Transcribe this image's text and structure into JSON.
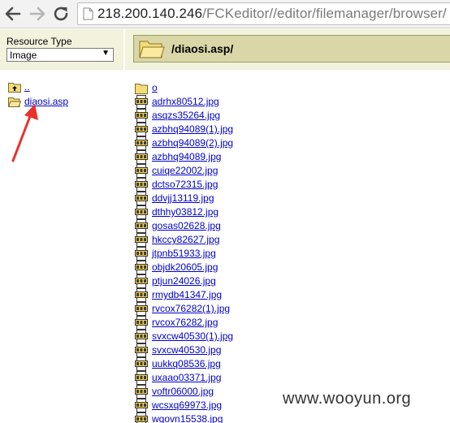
{
  "browser": {
    "url_host": "218.200.140.246",
    "url_path": "/FCKeditor//editor/filemanager/browser/"
  },
  "resource_type": {
    "label": "Resource Type",
    "selected": "Image"
  },
  "current_folder": "/diaosi.asp/",
  "tree": {
    "items": [
      {
        "label": ".."
      },
      {
        "label": "diaosi.asp"
      }
    ]
  },
  "files": [
    {
      "name": "o",
      "kind": "folder"
    },
    {
      "name": "adrhx80512.jpg",
      "kind": "jpg"
    },
    {
      "name": "asqzs35264.jpg",
      "kind": "jpg"
    },
    {
      "name": "azbhq94089(1).jpg",
      "kind": "jpg"
    },
    {
      "name": "azbhq94089(2).jpg",
      "kind": "jpg"
    },
    {
      "name": "azbhq94089.jpg",
      "kind": "jpg"
    },
    {
      "name": "cuiqe22002.jpg",
      "kind": "jpg"
    },
    {
      "name": "dctso72315.jpg",
      "kind": "jpg"
    },
    {
      "name": "ddvjj13119.jpg",
      "kind": "jpg"
    },
    {
      "name": "dthhy03812.jpg",
      "kind": "jpg"
    },
    {
      "name": "gosas02628.jpg",
      "kind": "jpg"
    },
    {
      "name": "hkccy82627.jpg",
      "kind": "jpg"
    },
    {
      "name": "jtpnb51933.jpg",
      "kind": "jpg"
    },
    {
      "name": "objdk20605.jpg",
      "kind": "jpg"
    },
    {
      "name": "ptjun24026.jpg",
      "kind": "jpg"
    },
    {
      "name": "rmydb41347.jpg",
      "kind": "jpg"
    },
    {
      "name": "rvcox76282(1).jpg",
      "kind": "jpg"
    },
    {
      "name": "rvcox76282.jpg",
      "kind": "jpg"
    },
    {
      "name": "svxcw40530(1).jpg",
      "kind": "jpg"
    },
    {
      "name": "svxcw40530.jpg",
      "kind": "jpg"
    },
    {
      "name": "uukkq08536.jpg",
      "kind": "jpg"
    },
    {
      "name": "uxaao03371.jpg",
      "kind": "jpg"
    },
    {
      "name": "voftr06000.jpg",
      "kind": "jpg"
    },
    {
      "name": "wcsxq69973.jpg",
      "kind": "jpg"
    },
    {
      "name": "wqovn15538.jpg",
      "kind": "jpg"
    }
  ],
  "icons": {
    "back": "back-arrow-icon",
    "forward": "forward-arrow-icon",
    "reload": "reload-icon",
    "page": "page-icon",
    "folder": "folder-icon",
    "folder_up": "folder-up-icon",
    "folder_open": "folder-open-icon",
    "jpg": "jpg-file-icon",
    "annotation": "red-annotation-arrow"
  },
  "colors": {
    "panel_bg": "#f2f2dd",
    "banner_bg": "#d9d7a7",
    "link": "#0000cc",
    "annotation": "#e8322b"
  },
  "watermark": "www.wooyun.org"
}
